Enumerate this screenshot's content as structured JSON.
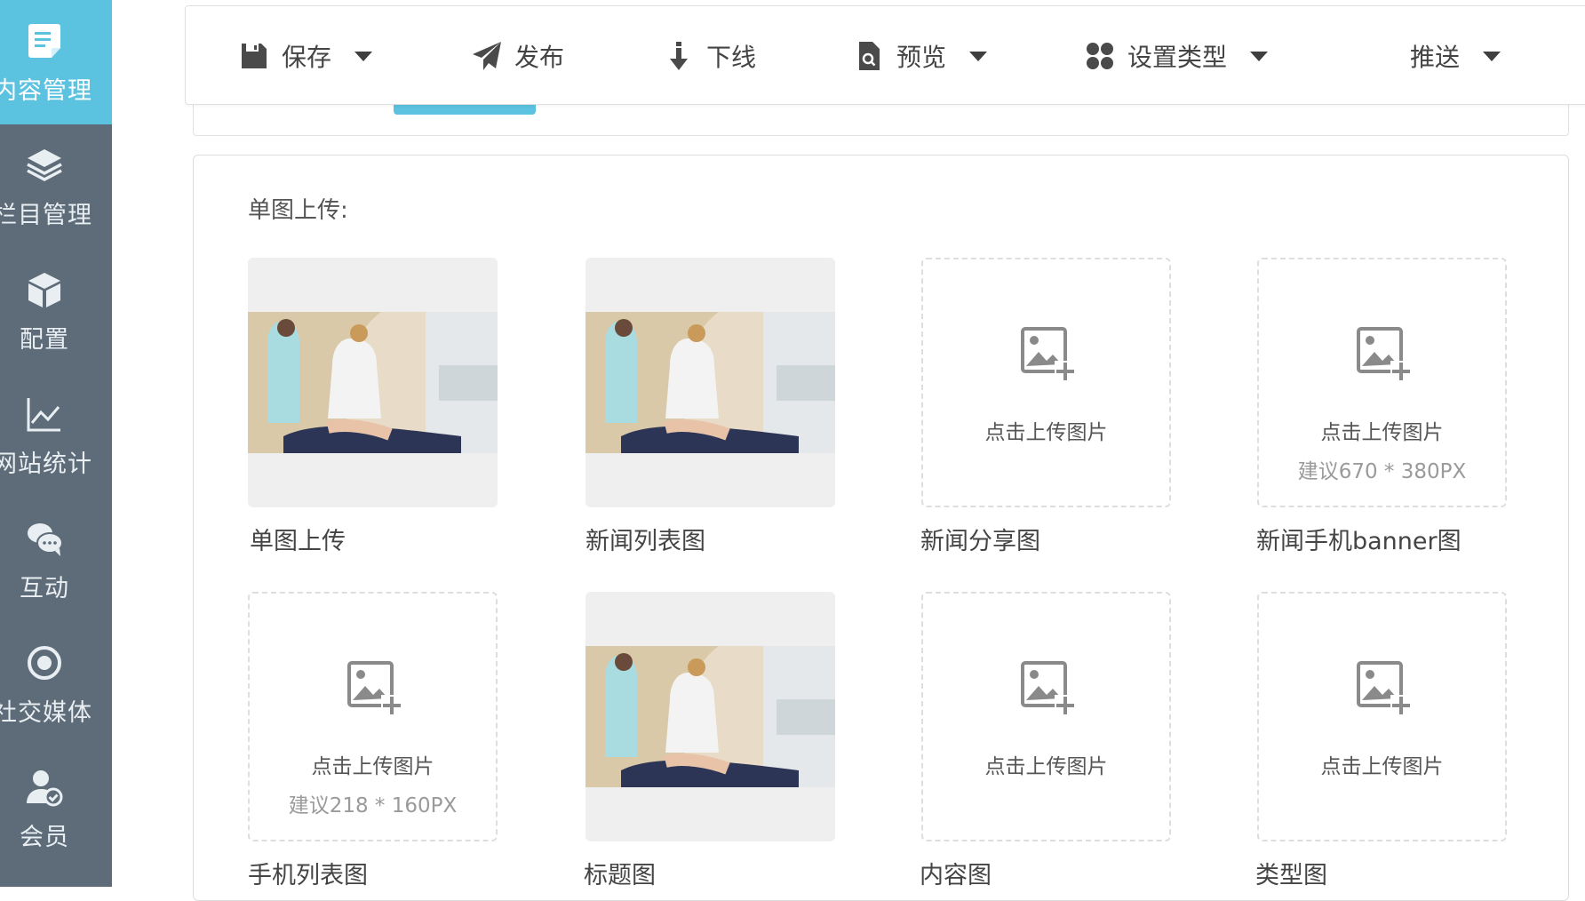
{
  "sidebar": {
    "items": [
      {
        "label": "内容管理",
        "icon": "document-icon",
        "active": true
      },
      {
        "label": "栏目管理",
        "icon": "layers-icon",
        "active": false
      },
      {
        "label": "配置",
        "icon": "cube-icon",
        "active": false
      },
      {
        "label": "网站统计",
        "icon": "line-chart-icon",
        "active": false
      },
      {
        "label": "互动",
        "icon": "chat-bubbles-icon",
        "active": false
      },
      {
        "label": "社交媒体",
        "icon": "target-icon",
        "active": false
      },
      {
        "label": "会员",
        "icon": "user-check-icon",
        "active": false
      }
    ]
  },
  "toolbar": {
    "save_label": "保存",
    "publish_label": "发布",
    "offline_label": "下线",
    "preview_label": "预览",
    "set_type_label": "设置类型",
    "push_label": "推送"
  },
  "section": {
    "title": "单图上传:"
  },
  "uploads": [
    {
      "caption": "单图上传",
      "state": "filled"
    },
    {
      "caption": "新闻列表图",
      "state": "filled"
    },
    {
      "caption": "新闻分享图",
      "state": "empty",
      "text": "点击上传图片",
      "hint": ""
    },
    {
      "caption": "新闻手机banner图",
      "state": "empty",
      "text": "点击上传图片",
      "hint": "建议670 * 380PX"
    },
    {
      "caption": "手机列表图",
      "state": "empty",
      "text": "点击上传图片",
      "hint": "建议218 * 160PX"
    },
    {
      "caption": "标题图",
      "state": "filled"
    },
    {
      "caption": "内容图",
      "state": "empty",
      "text": "点击上传图片",
      "hint": ""
    },
    {
      "caption": "类型图",
      "state": "empty",
      "text": "点击上传图片",
      "hint": ""
    }
  ],
  "colors": {
    "sidebar_bg": "#5d6c78",
    "accent": "#5bc2df",
    "panel_border": "#dcdcdc",
    "dashed_border": "#dedede"
  }
}
